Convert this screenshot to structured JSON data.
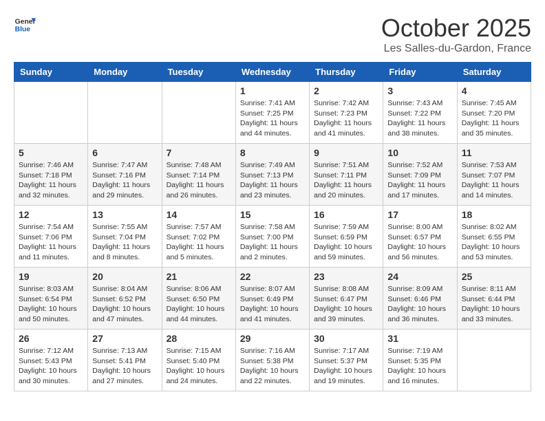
{
  "logo": {
    "general": "General",
    "blue": "Blue"
  },
  "title": "October 2025",
  "location": "Les Salles-du-Gardon, France",
  "headers": [
    "Sunday",
    "Monday",
    "Tuesday",
    "Wednesday",
    "Thursday",
    "Friday",
    "Saturday"
  ],
  "weeks": [
    [
      {
        "day": "",
        "info": ""
      },
      {
        "day": "",
        "info": ""
      },
      {
        "day": "",
        "info": ""
      },
      {
        "day": "1",
        "info": "Sunrise: 7:41 AM\nSunset: 7:25 PM\nDaylight: 11 hours and 44 minutes."
      },
      {
        "day": "2",
        "info": "Sunrise: 7:42 AM\nSunset: 7:23 PM\nDaylight: 11 hours and 41 minutes."
      },
      {
        "day": "3",
        "info": "Sunrise: 7:43 AM\nSunset: 7:22 PM\nDaylight: 11 hours and 38 minutes."
      },
      {
        "day": "4",
        "info": "Sunrise: 7:45 AM\nSunset: 7:20 PM\nDaylight: 11 hours and 35 minutes."
      }
    ],
    [
      {
        "day": "5",
        "info": "Sunrise: 7:46 AM\nSunset: 7:18 PM\nDaylight: 11 hours and 32 minutes."
      },
      {
        "day": "6",
        "info": "Sunrise: 7:47 AM\nSunset: 7:16 PM\nDaylight: 11 hours and 29 minutes."
      },
      {
        "day": "7",
        "info": "Sunrise: 7:48 AM\nSunset: 7:14 PM\nDaylight: 11 hours and 26 minutes."
      },
      {
        "day": "8",
        "info": "Sunrise: 7:49 AM\nSunset: 7:13 PM\nDaylight: 11 hours and 23 minutes."
      },
      {
        "day": "9",
        "info": "Sunrise: 7:51 AM\nSunset: 7:11 PM\nDaylight: 11 hours and 20 minutes."
      },
      {
        "day": "10",
        "info": "Sunrise: 7:52 AM\nSunset: 7:09 PM\nDaylight: 11 hours and 17 minutes."
      },
      {
        "day": "11",
        "info": "Sunrise: 7:53 AM\nSunset: 7:07 PM\nDaylight: 11 hours and 14 minutes."
      }
    ],
    [
      {
        "day": "12",
        "info": "Sunrise: 7:54 AM\nSunset: 7:06 PM\nDaylight: 11 hours and 11 minutes."
      },
      {
        "day": "13",
        "info": "Sunrise: 7:55 AM\nSunset: 7:04 PM\nDaylight: 11 hours and 8 minutes."
      },
      {
        "day": "14",
        "info": "Sunrise: 7:57 AM\nSunset: 7:02 PM\nDaylight: 11 hours and 5 minutes."
      },
      {
        "day": "15",
        "info": "Sunrise: 7:58 AM\nSunset: 7:00 PM\nDaylight: 11 hours and 2 minutes."
      },
      {
        "day": "16",
        "info": "Sunrise: 7:59 AM\nSunset: 6:59 PM\nDaylight: 10 hours and 59 minutes."
      },
      {
        "day": "17",
        "info": "Sunrise: 8:00 AM\nSunset: 6:57 PM\nDaylight: 10 hours and 56 minutes."
      },
      {
        "day": "18",
        "info": "Sunrise: 8:02 AM\nSunset: 6:55 PM\nDaylight: 10 hours and 53 minutes."
      }
    ],
    [
      {
        "day": "19",
        "info": "Sunrise: 8:03 AM\nSunset: 6:54 PM\nDaylight: 10 hours and 50 minutes."
      },
      {
        "day": "20",
        "info": "Sunrise: 8:04 AM\nSunset: 6:52 PM\nDaylight: 10 hours and 47 minutes."
      },
      {
        "day": "21",
        "info": "Sunrise: 8:06 AM\nSunset: 6:50 PM\nDaylight: 10 hours and 44 minutes."
      },
      {
        "day": "22",
        "info": "Sunrise: 8:07 AM\nSunset: 6:49 PM\nDaylight: 10 hours and 41 minutes."
      },
      {
        "day": "23",
        "info": "Sunrise: 8:08 AM\nSunset: 6:47 PM\nDaylight: 10 hours and 39 minutes."
      },
      {
        "day": "24",
        "info": "Sunrise: 8:09 AM\nSunset: 6:46 PM\nDaylight: 10 hours and 36 minutes."
      },
      {
        "day": "25",
        "info": "Sunrise: 8:11 AM\nSunset: 6:44 PM\nDaylight: 10 hours and 33 minutes."
      }
    ],
    [
      {
        "day": "26",
        "info": "Sunrise: 7:12 AM\nSunset: 5:43 PM\nDaylight: 10 hours and 30 minutes."
      },
      {
        "day": "27",
        "info": "Sunrise: 7:13 AM\nSunset: 5:41 PM\nDaylight: 10 hours and 27 minutes."
      },
      {
        "day": "28",
        "info": "Sunrise: 7:15 AM\nSunset: 5:40 PM\nDaylight: 10 hours and 24 minutes."
      },
      {
        "day": "29",
        "info": "Sunrise: 7:16 AM\nSunset: 5:38 PM\nDaylight: 10 hours and 22 minutes."
      },
      {
        "day": "30",
        "info": "Sunrise: 7:17 AM\nSunset: 5:37 PM\nDaylight: 10 hours and 19 minutes."
      },
      {
        "day": "31",
        "info": "Sunrise: 7:19 AM\nSunset: 5:35 PM\nDaylight: 10 hours and 16 minutes."
      },
      {
        "day": "",
        "info": ""
      }
    ]
  ]
}
